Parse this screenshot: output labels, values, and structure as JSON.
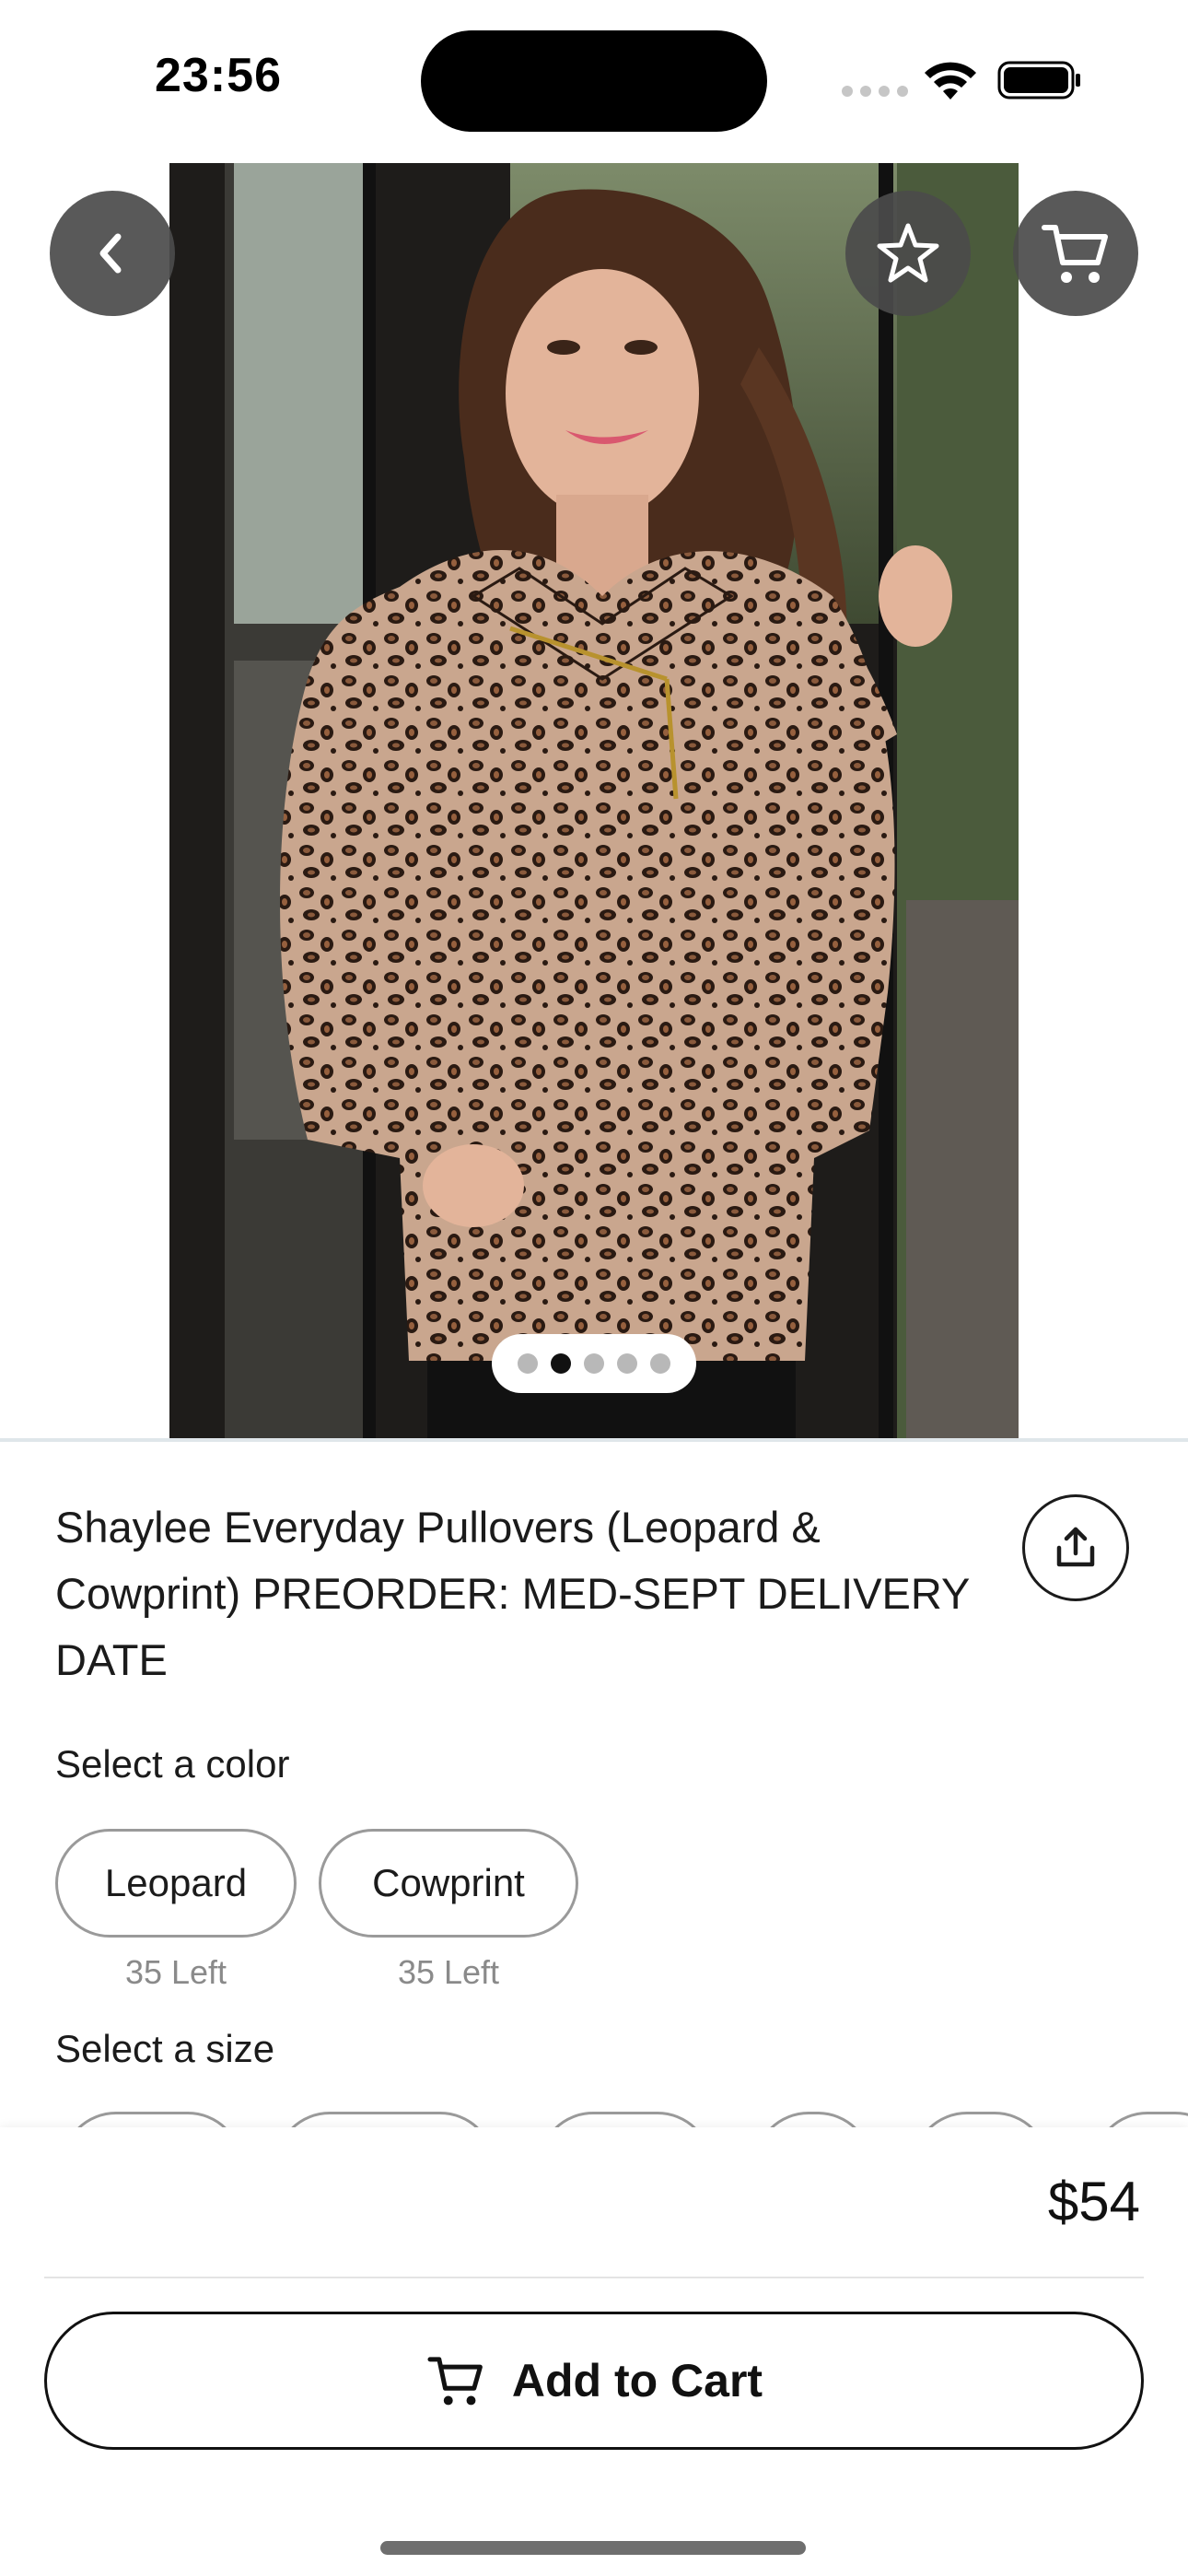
{
  "status_bar": {
    "time": "23:56"
  },
  "nav": {
    "back_icon": "chevron-left-icon",
    "favorite_icon": "star-outline-icon",
    "cart_icon": "cart-icon"
  },
  "gallery": {
    "total_images": 5,
    "active_index": 1
  },
  "product": {
    "title": "Shaylee Everyday Pullovers (Leopard & Cowprint) PREORDER: MED-SEPT DELIVERY DATE",
    "share_icon": "share-icon",
    "price": "$54"
  },
  "color_section": {
    "label": "Select a color",
    "options": [
      {
        "name": "Leopard",
        "stock": "35 Left"
      },
      {
        "name": "Cowprint",
        "stock": "35 Left"
      }
    ]
  },
  "size_section": {
    "label": "Select a size"
  },
  "cart": {
    "add_label": "Add to Cart",
    "icon": "cart-icon"
  },
  "colors": {
    "accent": "#111111",
    "pill_border": "#9a9a9a",
    "muted_text": "#8a8a8a",
    "overlay_button": "#4b4b4b"
  }
}
